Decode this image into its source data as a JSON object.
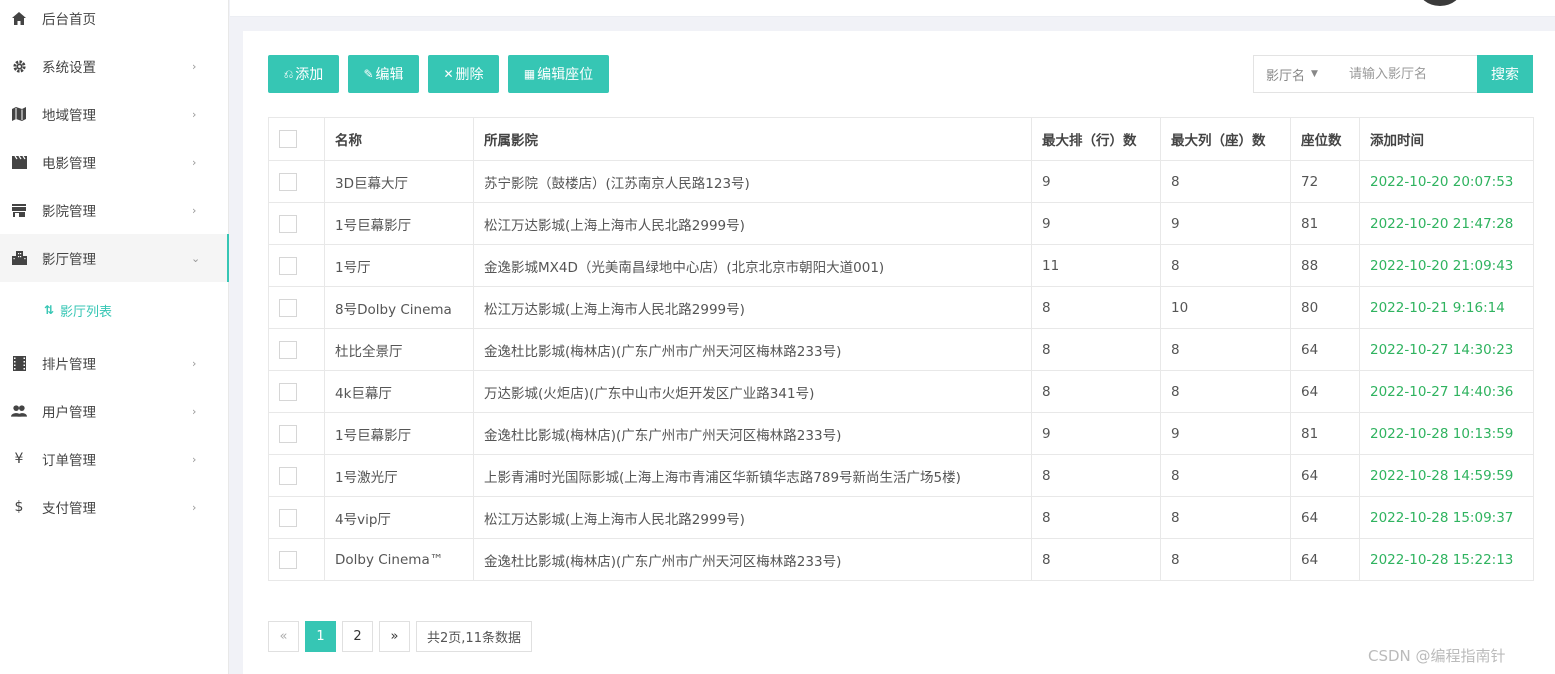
{
  "sidebar": {
    "items": [
      {
        "label": "后台首页",
        "icon": "home-icon"
      },
      {
        "label": "系统设置",
        "icon": "gear-icon"
      },
      {
        "label": "地域管理",
        "icon": "map-icon"
      },
      {
        "label": "电影管理",
        "icon": "clapperboard-icon"
      },
      {
        "label": "影院管理",
        "icon": "store-icon"
      },
      {
        "label": "影厅管理",
        "icon": "building-icon"
      },
      {
        "label": "排片管理",
        "icon": "film-strip-icon"
      },
      {
        "label": "用户管理",
        "icon": "users-icon"
      },
      {
        "label": "订单管理",
        "icon": "yen-icon"
      },
      {
        "label": "支付管理",
        "icon": "dollar-icon"
      }
    ],
    "sub_item": {
      "label": "影厅列表"
    },
    "active_item": "影厅管理"
  },
  "toolbar": {
    "add_label": "添加",
    "edit_label": "编辑",
    "delete_label": "删除",
    "edit_seats_label": "编辑座位"
  },
  "search": {
    "field_select": "影厅名",
    "placeholder": "请输入影厅名",
    "button_label": "搜索"
  },
  "table": {
    "headers": [
      "",
      "名称",
      "所属影院",
      "最大排（行）数",
      "最大列（座）数",
      "座位数",
      "添加时间"
    ],
    "rows": [
      {
        "name": "3D巨幕大厅",
        "cinema": "苏宁影院（鼓楼店）(江苏南京人民路123号)",
        "rows": "9",
        "cols": "8",
        "seats": "72",
        "time": "2022-10-20 20:07:53"
      },
      {
        "name": "1号巨幕影厅",
        "cinema": "松江万达影城(上海上海市人民北路2999号)",
        "rows": "9",
        "cols": "9",
        "seats": "81",
        "time": "2022-10-20 21:47:28"
      },
      {
        "name": "1号厅",
        "cinema": "金逸影城MX4D（光美南昌绿地中心店）(北京北京市朝阳大道001)",
        "rows": "11",
        "cols": "8",
        "seats": "88",
        "time": "2022-10-20 21:09:43"
      },
      {
        "name": "8号Dolby Cinema",
        "cinema": "松江万达影城(上海上海市人民北路2999号)",
        "rows": "8",
        "cols": "10",
        "seats": "80",
        "time": "2022-10-21 9:16:14"
      },
      {
        "name": "杜比全景厅",
        "cinema": "金逸杜比影城(梅林店)(广东广州市广州天河区梅林路233号)",
        "rows": "8",
        "cols": "8",
        "seats": "64",
        "time": "2022-10-27 14:30:23"
      },
      {
        "name": "4k巨幕厅",
        "cinema": "万达影城(火炬店)(广东中山市火炬开发区广业路341号)",
        "rows": "8",
        "cols": "8",
        "seats": "64",
        "time": "2022-10-27 14:40:36"
      },
      {
        "name": "1号巨幕影厅",
        "cinema": "金逸杜比影城(梅林店)(广东广州市广州天河区梅林路233号)",
        "rows": "9",
        "cols": "9",
        "seats": "81",
        "time": "2022-10-28 10:13:59"
      },
      {
        "name": "1号激光厅",
        "cinema": "上影青浦时光国际影城(上海上海市青浦区华新镇华志路789号新尚生活广场5楼)",
        "rows": "8",
        "cols": "8",
        "seats": "64",
        "time": "2022-10-28 14:59:59"
      },
      {
        "name": "4号vip厅",
        "cinema": "松江万达影城(上海上海市人民北路2999号)",
        "rows": "8",
        "cols": "8",
        "seats": "64",
        "time": "2022-10-28 15:09:37"
      },
      {
        "name": "Dolby Cinema™",
        "cinema": "金逸杜比影城(梅林店)(广东广州市广州天河区梅林路233号)",
        "rows": "8",
        "cols": "8",
        "seats": "64",
        "time": "2022-10-28 15:22:13"
      }
    ]
  },
  "pagination": {
    "prev": "«",
    "pages": [
      "1",
      "2"
    ],
    "current": "1",
    "next": "»",
    "summary": "共2页,11条数据"
  },
  "watermark": "CSDN @编程指南针",
  "colors": {
    "accent": "#36c6b4",
    "time_text": "#2fb35f"
  }
}
